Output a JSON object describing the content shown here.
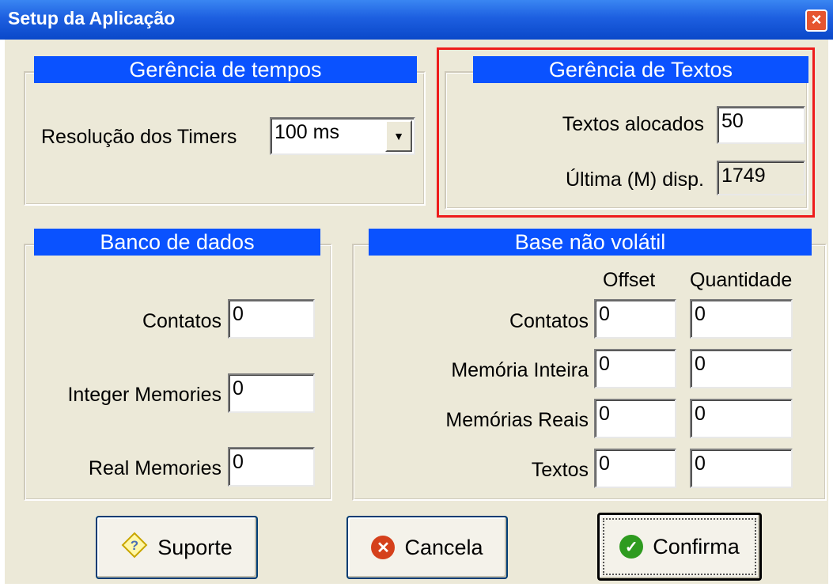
{
  "window": {
    "title": "Setup da Aplicação",
    "close_icon": "close-icon"
  },
  "gerencia_tempos": {
    "title": "Gerência de tempos",
    "resolucao_label": "Resolução dos Timers",
    "resolucao_value": "100 ms"
  },
  "gerencia_textos": {
    "title": "Gerência de Textos",
    "textos_alocados_label": "Textos alocados",
    "textos_alocados_value": "50",
    "ultima_label": "Última (M) disp.",
    "ultima_value": "1749"
  },
  "banco_dados": {
    "title": "Banco de dados",
    "contatos_label": "Contatos",
    "contatos_value": "0",
    "integer_label": "Integer Memories",
    "integer_value": "0",
    "real_label": "Real Memories",
    "real_value": "0"
  },
  "base_nao_volatil": {
    "title": "Base não volátil",
    "col_offset": "Offset",
    "col_quantidade": "Quantidade",
    "rows": [
      {
        "label": "Contatos",
        "offset": "0",
        "quantidade": "0"
      },
      {
        "label": "Memória Inteira",
        "offset": "0",
        "quantidade": "0"
      },
      {
        "label": "Memórias Reais",
        "offset": "0",
        "quantidade": "0"
      },
      {
        "label": "Textos",
        "offset": "0",
        "quantidade": "0"
      }
    ]
  },
  "buttons": {
    "suporte": "Suporte",
    "cancela": "Cancela",
    "confirma": "Confirma"
  },
  "colors": {
    "group_title_bg": "#0a52ff",
    "highlight_border": "#ee1c1c",
    "dialog_bg": "#ece9d8"
  }
}
